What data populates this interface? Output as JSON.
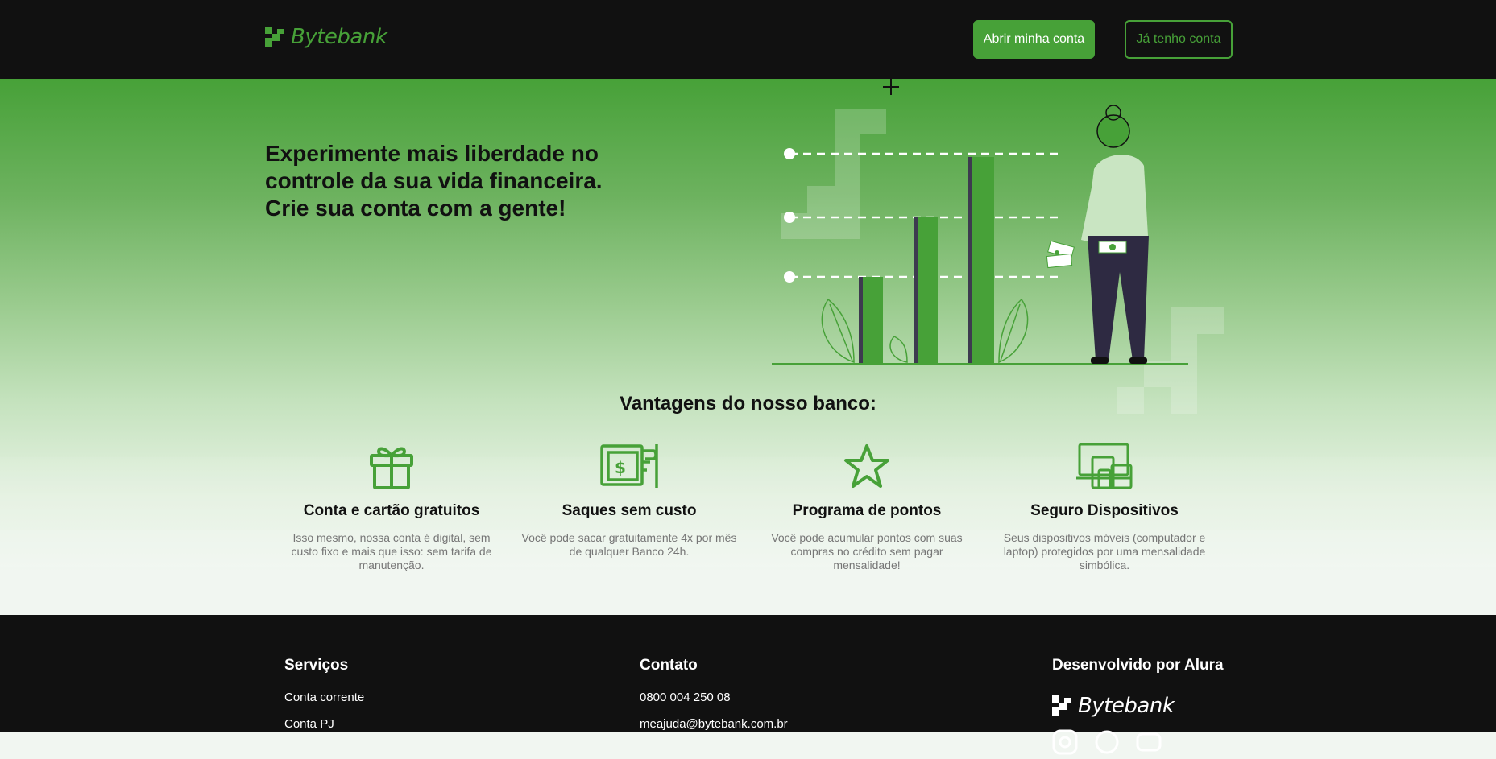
{
  "header": {
    "logo_text": "Bytebank",
    "open_account_label": "Abrir minha conta",
    "have_account_label": "Já tenho conta"
  },
  "hero": {
    "title_line1": "Experimente mais liberdade no",
    "title_line2": "controle da sua vida financeira.",
    "title_line3": "Crie sua conta com a gente!",
    "illustration_icon": "finance-growth-illustration"
  },
  "advantages": {
    "title": "Vantagens do nosso banco:",
    "items": [
      {
        "icon": "gift-icon",
        "title": "Conta e cartão gratuitos",
        "text": "Isso mesmo, nossa conta é digital, sem custo fixo e mais que isso: sem tarifa de manutenção."
      },
      {
        "icon": "cash-withdraw-icon",
        "title": "Saques sem custo",
        "text": "Você pode sacar gratuitamente 4x por mês de qualquer Banco 24h."
      },
      {
        "icon": "star-icon",
        "title": "Programa de pontos",
        "text": "Você pode acumular pontos com suas compras no crédito sem pagar mensalidade!"
      },
      {
        "icon": "devices-icon",
        "title": "Seguro Dispositivos",
        "text": "Seus dispositivos móveis (computador e laptop) protegidos por uma mensalidade simbólica."
      }
    ]
  },
  "footer": {
    "services_heading": "Serviços",
    "services": [
      "Conta corrente",
      "Conta PJ"
    ],
    "contact_heading": "Contato",
    "phone": "0800 004 250 08",
    "email": "meajuda@bytebank.com.br",
    "dev_heading": "Desenvolvido por Alura",
    "logo_text": "Bytebank",
    "social_icons": [
      "instagram-icon",
      "whatsapp-icon",
      "youtube-icon"
    ]
  },
  "colors": {
    "brand_green": "#47a138",
    "header_bg": "#111111",
    "text_dark": "#111111",
    "text_muted": "#767676"
  }
}
